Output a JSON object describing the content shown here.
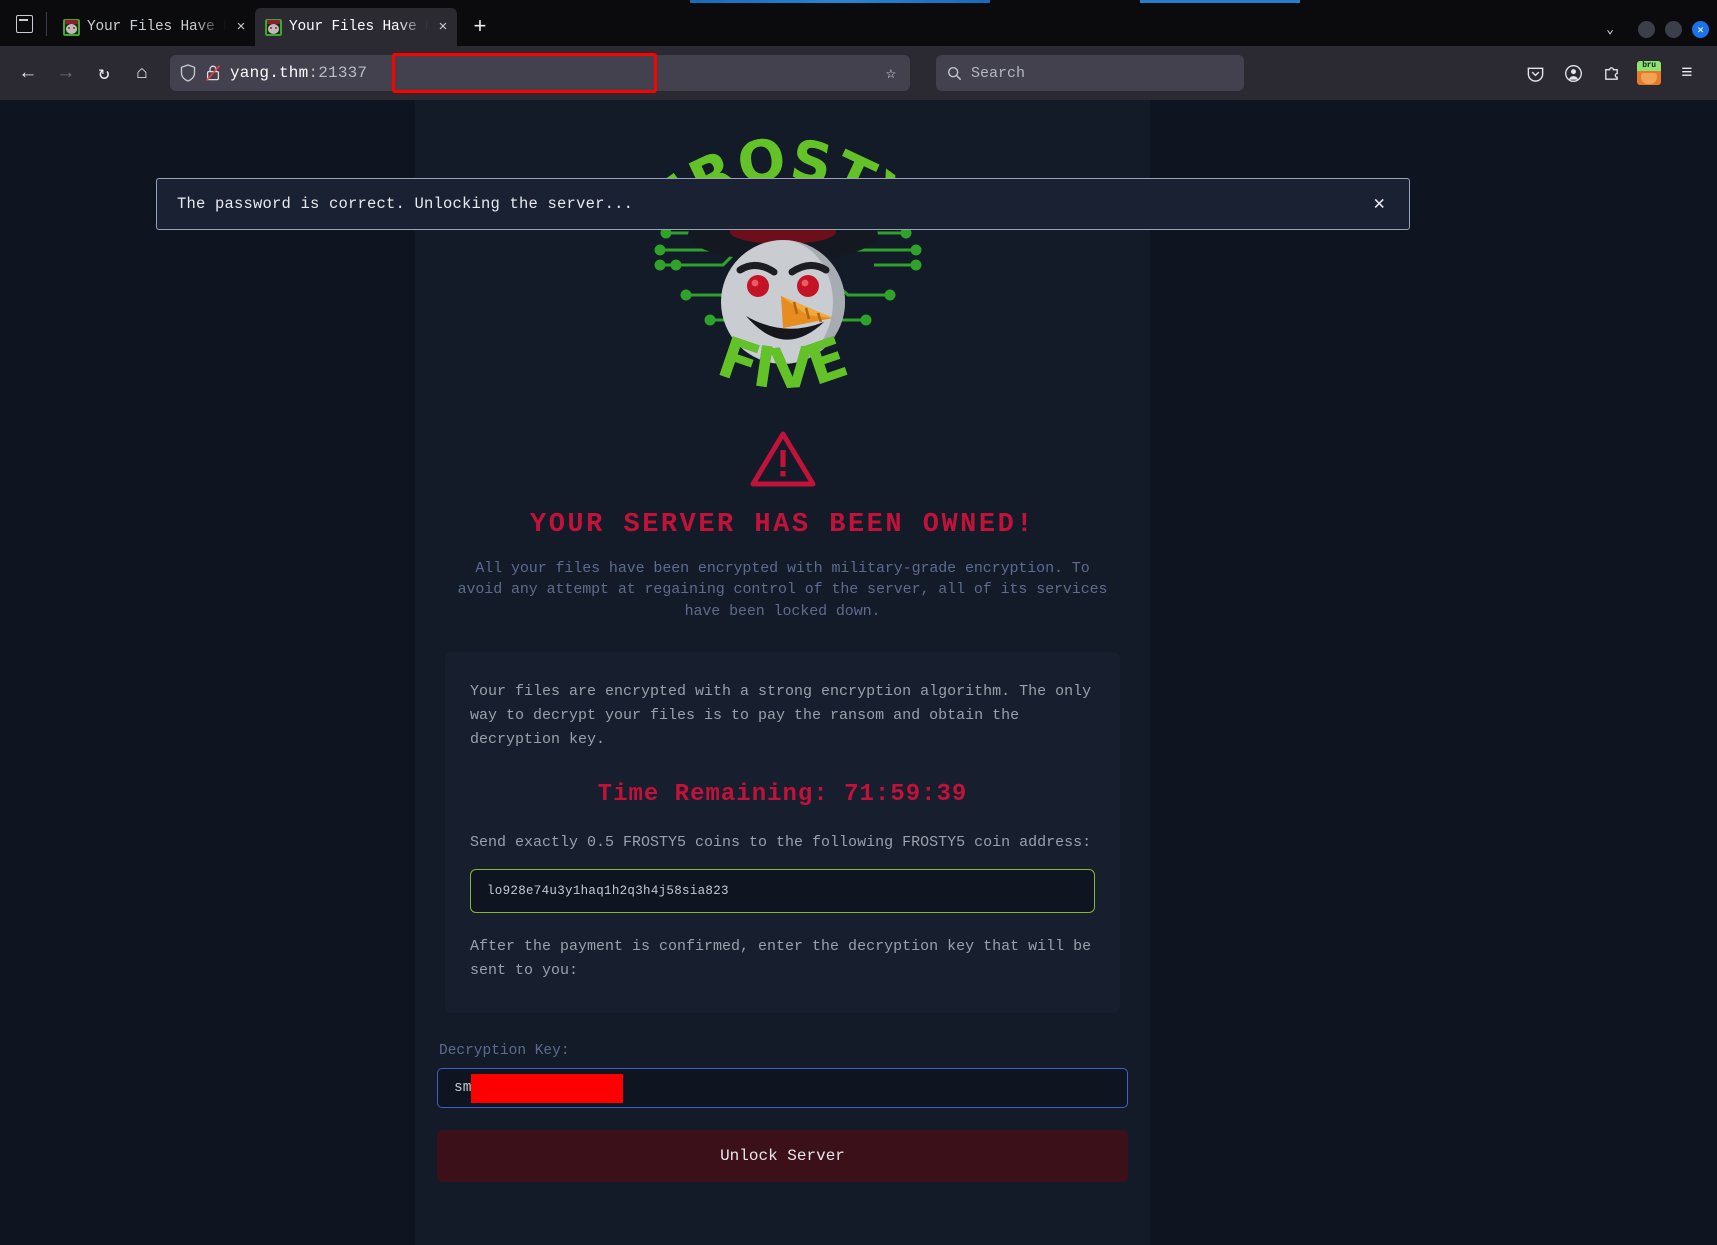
{
  "browser": {
    "tabs": [
      {
        "title": "Your Files Have Bee",
        "close": "×",
        "favicon": "frosty-favicon"
      },
      {
        "title": "Your Files Have Bee",
        "close": "×",
        "favicon": "frosty-favicon"
      }
    ],
    "newtab_label": "+",
    "window_controls": {
      "chevron": "⌄",
      "close": "✕"
    },
    "nav": {
      "back": "←",
      "forward": "→",
      "reload": "↻",
      "home": "⌂"
    },
    "url": {
      "host": "yang.thm",
      "port": ":21337",
      "bookmark_star": "☆"
    },
    "search": {
      "placeholder": "Search",
      "icon": "search-icon"
    },
    "toolbar_icons": [
      "pocket-icon",
      "account-icon",
      "extensions-icon",
      "bruno-extension-icon",
      "app-menu-icon"
    ],
    "menu_glyph": "≡",
    "bruno_label": "bru"
  },
  "banner": {
    "message": "The password is correct. Unlocking the server...",
    "close_label": "✕"
  },
  "page": {
    "logo_alt": "FROSTY FIVE",
    "logo_text_top": "FROSTY",
    "logo_text_bottom": "FIVE",
    "heading": "YOUR SERVER HAS BEEN OWNED!",
    "lede": "All your files have been encrypted with military-grade encryption. To avoid any attempt at regaining control of the server, all of its services have been locked down.",
    "info_paragraph": "Your files are encrypted with a strong encryption algorithm. The only way to decrypt your files is to pay the ransom and obtain the decryption key.",
    "timer": "Time Remaining: 71:59:39",
    "send_line": "Send exactly 0.5 FROSTY5 coins to the following FROSTY5 coin address:",
    "coin_address": "lo928e74u3y1haq1h2q3h4j58sia823",
    "after_payment": "After the payment is confirmed, enter the decryption key that will be sent to you:",
    "key_label": "Decryption Key:",
    "key_value": "sm",
    "unlock_button": "Unlock Server"
  },
  "colors": {
    "danger": "#c1123a",
    "accent_green": "#88b630",
    "panel": "#131a28",
    "page_bg": "#0e1420",
    "redaction": "#ff0000",
    "url_highlight": "#ff0000",
    "input_border_blue": "#3c62c8"
  }
}
